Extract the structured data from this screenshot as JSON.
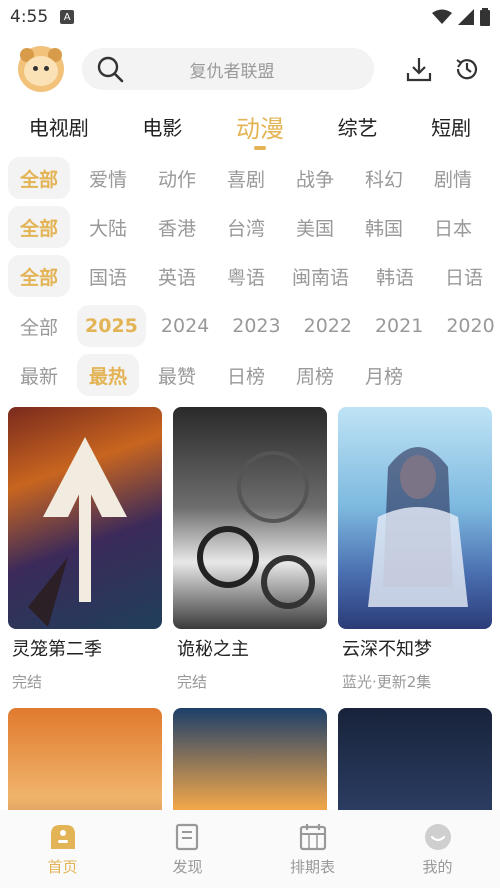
{
  "status_bar": {
    "time": "4:55",
    "a_badge": "A"
  },
  "header": {
    "search_placeholder": "复仇者联盟"
  },
  "main_tabs": [
    {
      "label": "电视剧"
    },
    {
      "label": "电影"
    },
    {
      "label": "动漫"
    },
    {
      "label": "综艺"
    },
    {
      "label": "短剧"
    }
  ],
  "filters": {
    "genre": [
      "全部",
      "爱情",
      "动作",
      "喜剧",
      "战争",
      "科幻",
      "剧情"
    ],
    "region": [
      "全部",
      "大陆",
      "香港",
      "台湾",
      "美国",
      "韩国",
      "日本"
    ],
    "language": [
      "全部",
      "国语",
      "英语",
      "粤语",
      "闽南语",
      "韩语",
      "日语"
    ],
    "year": [
      "全部",
      "2025",
      "2024",
      "2023",
      "2022",
      "2021",
      "2020"
    ],
    "sort": [
      "最新",
      "最热",
      "最赞",
      "日榜",
      "周榜",
      "月榜"
    ]
  },
  "cards": [
    {
      "title": "灵笼第二季",
      "status": "完结"
    },
    {
      "title": "诡秘之主",
      "status": "完结"
    },
    {
      "title": "云深不知梦",
      "status": "蓝光·更新2集"
    },
    {
      "title": "",
      "status": ""
    },
    {
      "title": "",
      "status": ""
    },
    {
      "title": "",
      "status": ""
    }
  ],
  "bottom_nav": [
    {
      "label": "首页"
    },
    {
      "label": "发现"
    },
    {
      "label": "排期表"
    },
    {
      "label": "我的"
    }
  ],
  "colors": {
    "accent": "#e3b455",
    "muted": "#999999"
  }
}
